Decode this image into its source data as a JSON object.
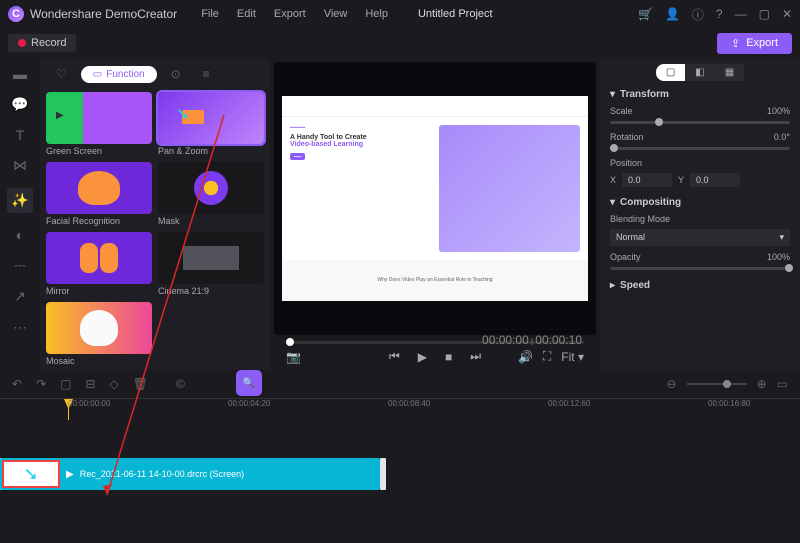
{
  "app": {
    "name": "Wondershare DemoCreator",
    "logo": "C"
  },
  "menu": {
    "file": "File",
    "edit": "Edit",
    "export": "Export",
    "view": "View",
    "help": "Help",
    "project": "Untitled Project"
  },
  "titlebar_icons": {
    "cart": "🛒",
    "user": "👤",
    "info": "ⓘ",
    "help": "?",
    "min": "—",
    "max": "▢",
    "close": "✕"
  },
  "toolbar": {
    "record": "Record",
    "export": "Export"
  },
  "effects": {
    "tab_function": "Function",
    "items": [
      {
        "label": "Green Screen"
      },
      {
        "label": "Pan & Zoom"
      },
      {
        "label": "Facial Recognition"
      },
      {
        "label": "Mask"
      },
      {
        "label": "Mirror"
      },
      {
        "label": "Cinema 21:9"
      },
      {
        "label": "Mosaic"
      }
    ]
  },
  "preview": {
    "headline1": "A Handy Tool to Create",
    "headline2": "Video-based Learning",
    "footer": "Why Does Video Play an Essential Role in Teaching",
    "time_current": "00:00:00",
    "time_total": "00:00:10",
    "fit": "Fit"
  },
  "props": {
    "tab_video": "▢",
    "tab_audio": "◧",
    "tab_color": "▦",
    "transform": {
      "header": "Transform",
      "scale": "Scale",
      "scale_val": "100%",
      "rotation": "Rotation",
      "rotation_val": "0.0°",
      "position": "Position",
      "x_label": "X",
      "x_val": "0.0",
      "y_label": "Y",
      "y_val": "0.0"
    },
    "compositing": {
      "header": "Compositing",
      "blend": "Blending Mode",
      "blend_val": "Normal",
      "opacity": "Opacity",
      "opacity_val": "100%"
    },
    "speed": {
      "header": "Speed"
    }
  },
  "timeline": {
    "marks": [
      "00:00:00:00",
      "00:00:04:20",
      "00:00:08:40",
      "00:00:12:60",
      "00:00:16:80"
    ],
    "clip_label": "Rec_2021-06-11 14-10-00.drcrc (Screen)"
  }
}
